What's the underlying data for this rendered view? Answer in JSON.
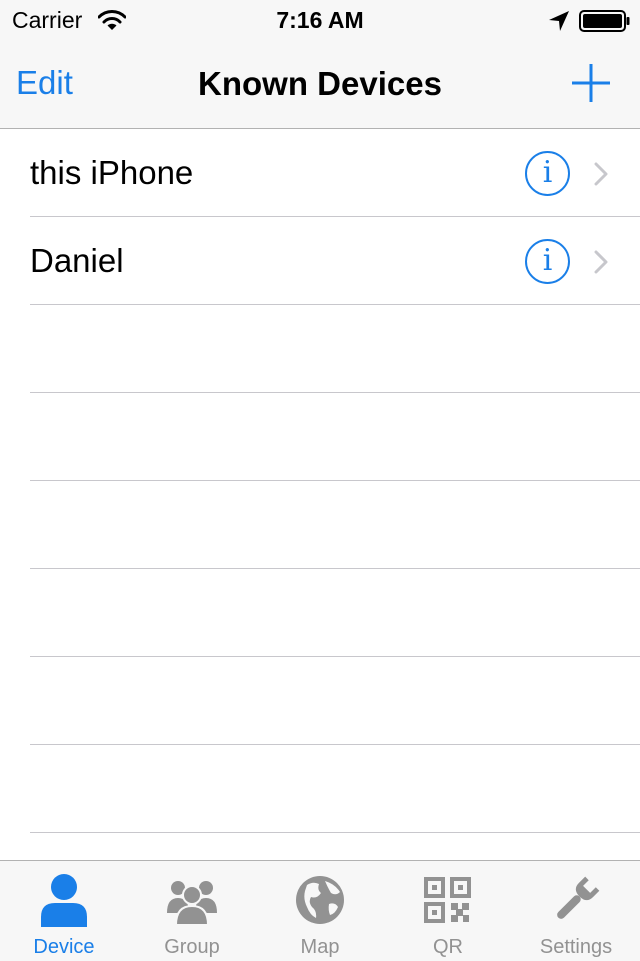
{
  "status_bar": {
    "carrier": "Carrier",
    "time": "7:16 AM",
    "icons": [
      "wifi-icon",
      "location-arrow-icon",
      "battery-icon"
    ]
  },
  "nav_bar": {
    "edit_label": "Edit",
    "title": "Known Devices",
    "add_icon": "plus-icon"
  },
  "devices": [
    {
      "name": "this iPhone",
      "info_icon": "info-icon",
      "disclosure_icon": "chevron-right-icon"
    },
    {
      "name": "Daniel",
      "info_icon": "info-icon",
      "disclosure_icon": "chevron-right-icon"
    }
  ],
  "info_glyph": "i",
  "tabs": [
    {
      "label": "Device",
      "icon": "person-icon",
      "active": true
    },
    {
      "label": "Group",
      "icon": "group-icon",
      "active": false
    },
    {
      "label": "Map",
      "icon": "globe-icon",
      "active": false
    },
    {
      "label": "QR",
      "icon": "qr-code-icon",
      "active": false
    },
    {
      "label": "Settings",
      "icon": "wrench-icon",
      "active": false
    }
  ],
  "colors": {
    "accent": "#1a7fe8",
    "inactive_tab": "#929292",
    "bar_background": "#f7f7f7",
    "separator": "#c8c7cc"
  }
}
